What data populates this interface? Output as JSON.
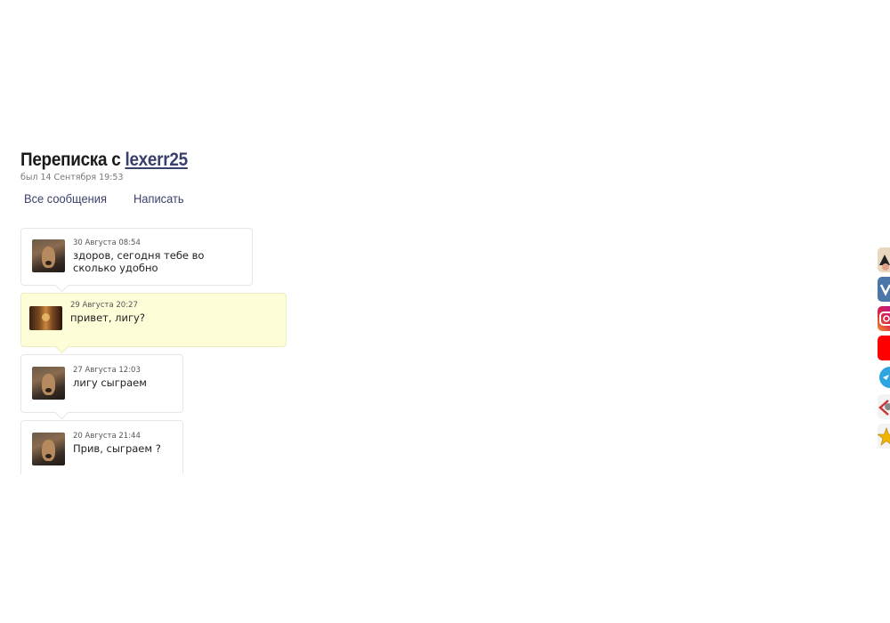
{
  "header": {
    "title_prefix": "Переписка с",
    "username": "lexerr25",
    "last_seen": "был 14 Сентября 19:53"
  },
  "tabs": [
    {
      "label": "Все сообщения"
    },
    {
      "label": "Написать"
    }
  ],
  "messages": [
    {
      "time": "30 Августа 08:54",
      "text": "здоров, сегодня тебе во сколько удобно",
      "mine": false
    },
    {
      "time": "29 Августа 20:27",
      "text": "привет, лигу?",
      "mine": true
    },
    {
      "time": "27 Августа 12:03",
      "text": "лигу сыграем",
      "mine": false
    },
    {
      "time": "20 Августа 21:44",
      "text": "Прив, сыграем ?",
      "mine": false
    }
  ],
  "social": [
    {
      "icon": "avatar-icon",
      "color": "#444444"
    },
    {
      "icon": "vk-icon",
      "color": "#4a76a8"
    },
    {
      "icon": "instagram-icon",
      "color": "#c13584"
    },
    {
      "icon": "youtube-icon",
      "color": "#ff0000"
    },
    {
      "icon": "telegram-icon",
      "color": "#2ca5e0"
    },
    {
      "icon": "link-icon",
      "color": "#cc3333"
    },
    {
      "icon": "star-icon",
      "color": "#f0b400"
    }
  ]
}
